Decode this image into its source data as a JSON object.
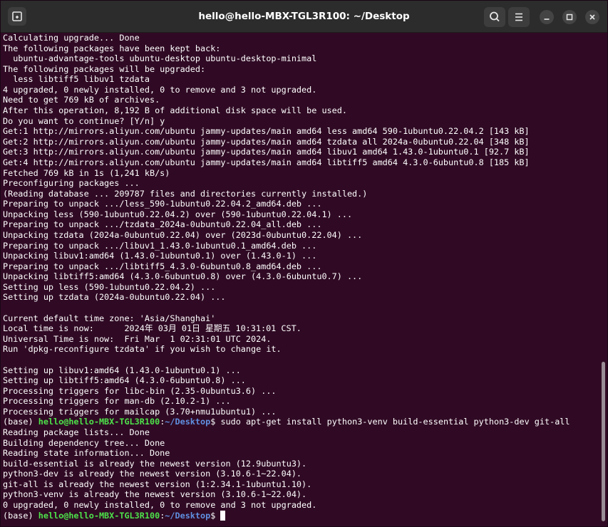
{
  "window": {
    "title": "hello@hello-MBX-TGL3R100: ~/Desktop",
    "accent": "#300a24"
  },
  "icons": {
    "new_tab": "new-tab-icon",
    "search": "search-icon",
    "menu": "hamburger-menu-icon",
    "minimize": "minimize-icon",
    "maximize": "maximize-icon",
    "close": "close-icon"
  },
  "terminal": {
    "prompt_user": "hello@hello-MBX-TGL3R100",
    "prompt_path": "~/Desktop",
    "command": "sudo apt-get install python3-venv build-essential python3-dev git-all",
    "lines": [
      "Calculating upgrade... Done",
      "The following packages have been kept back:",
      "  ubuntu-advantage-tools ubuntu-desktop ubuntu-desktop-minimal",
      "The following packages will be upgraded:",
      "  less libtiff5 libuv1 tzdata",
      "4 upgraded, 0 newly installed, 0 to remove and 3 not upgraded.",
      "Need to get 769 kB of archives.",
      "After this operation, 8,192 B of additional disk space will be used.",
      "Do you want to continue? [Y/n] y",
      "Get:1 http://mirrors.aliyun.com/ubuntu jammy-updates/main amd64 less amd64 590-1ubuntu0.22.04.2 [143 kB]",
      "Get:2 http://mirrors.aliyun.com/ubuntu jammy-updates/main amd64 tzdata all 2024a-0ubuntu0.22.04 [348 kB]",
      "Get:3 http://mirrors.aliyun.com/ubuntu jammy-updates/main amd64 libuv1 amd64 1.43.0-1ubuntu0.1 [92.7 kB]",
      "Get:4 http://mirrors.aliyun.com/ubuntu jammy-updates/main amd64 libtiff5 amd64 4.3.0-6ubuntu0.8 [185 kB]",
      "Fetched 769 kB in 1s (1,241 kB/s)",
      "Preconfiguring packages ...",
      "(Reading database ... 209787 files and directories currently installed.)",
      "Preparing to unpack .../less_590-1ubuntu0.22.04.2_amd64.deb ...",
      "Unpacking less (590-1ubuntu0.22.04.2) over (590-1ubuntu0.22.04.1) ...",
      "Preparing to unpack .../tzdata_2024a-0ubuntu0.22.04_all.deb ...",
      "Unpacking tzdata (2024a-0ubuntu0.22.04) over (2023d-0ubuntu0.22.04) ...",
      "Preparing to unpack .../libuv1_1.43.0-1ubuntu0.1_amd64.deb ...",
      "Unpacking libuv1:amd64 (1.43.0-1ubuntu0.1) over (1.43.0-1) ...",
      "Preparing to unpack .../libtiff5_4.3.0-6ubuntu0.8_amd64.deb ...",
      "Unpacking libtiff5:amd64 (4.3.0-6ubuntu0.8) over (4.3.0-6ubuntu0.7) ...",
      "Setting up less (590-1ubuntu0.22.04.2) ...",
      "Setting up tzdata (2024a-0ubuntu0.22.04) ...",
      "",
      "Current default time zone: 'Asia/Shanghai'",
      "Local time is now:      2024年 03月 01日 星期五 10:31:01 CST.",
      "Universal Time is now:  Fri Mar  1 02:31:01 UTC 2024.",
      "Run 'dpkg-reconfigure tzdata' if you wish to change it.",
      "",
      "Setting up libuv1:amd64 (1.43.0-1ubuntu0.1) ...",
      "Setting up libtiff5:amd64 (4.3.0-6ubuntu0.8) ...",
      "Processing triggers for libc-bin (2.35-0ubuntu3.6) ...",
      "Processing triggers for man-db (2.10.2-1) ...",
      "Processing triggers for mailcap (3.70+nmu1ubuntu1) ..."
    ],
    "output2": [
      "Reading package lists... Done",
      "Building dependency tree... Done",
      "Reading state information... Done",
      "build-essential is already the newest version (12.9ubuntu3).",
      "python3-dev is already the newest version (3.10.6-1~22.04).",
      "git-all is already the newest version (1:2.34.1-1ubuntu1.10).",
      "python3-venv is already the newest version (3.10.6-1~22.04).",
      "0 upgraded, 0 newly installed, 0 to remove and 3 not upgraded."
    ]
  }
}
